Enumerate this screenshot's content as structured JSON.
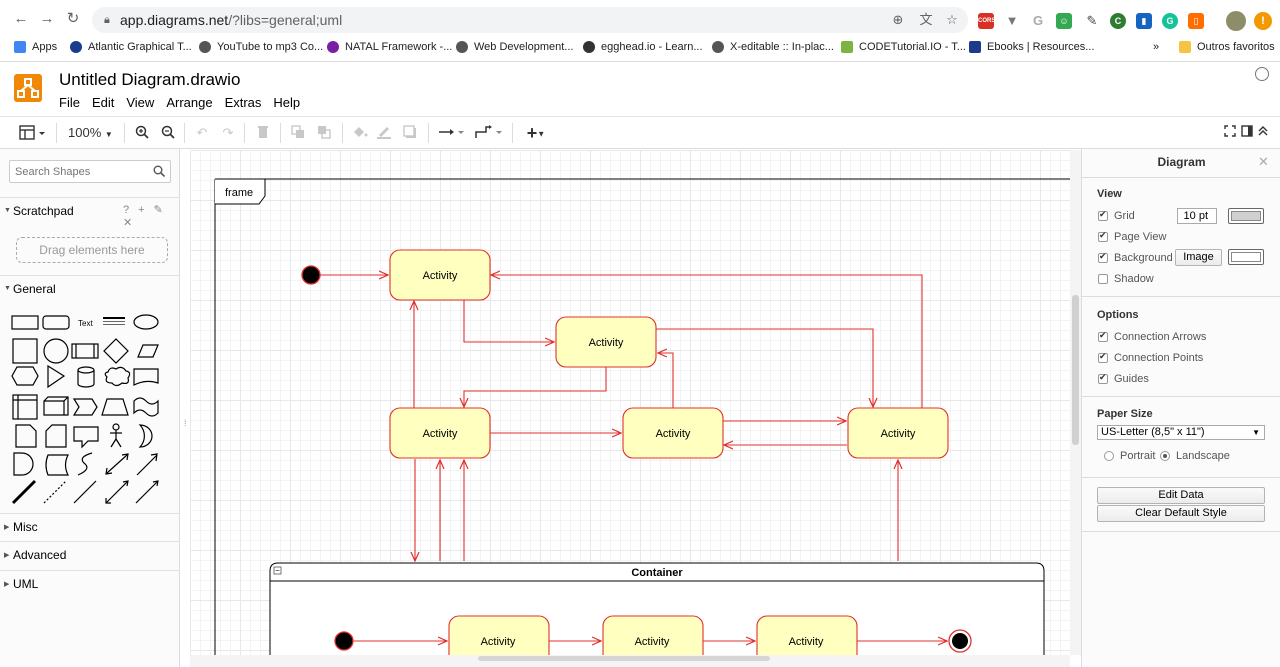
{
  "browser": {
    "url_host": "app.diagrams.net",
    "url_path": "/?libs=general;uml",
    "bookmarks": [
      {
        "label": "Apps",
        "color": "#4285f4"
      },
      {
        "label": "Atlantic Graphical T...",
        "color": "#1a3c8c"
      },
      {
        "label": "YouTube to mp3 Co...",
        "color": "#555555"
      },
      {
        "label": "NATAL Framework -...",
        "color": "#7b1fa2"
      },
      {
        "label": "Web Development...",
        "color": "#555555"
      },
      {
        "label": "egghead.io - Learn...",
        "color": "#333333"
      },
      {
        "label": "X-editable :: In-plac...",
        "color": "#555555"
      },
      {
        "label": "CODETutorial.IO - T...",
        "color": "#7cb342"
      },
      {
        "label": "Ebooks | Resources...",
        "color": "#1e3a8a"
      },
      {
        "label": "Outros favoritos",
        "color": "#f5c542"
      }
    ],
    "more_bookmarks": "»",
    "ext_cors": "CORS"
  },
  "app": {
    "title": "Untitled Diagram.drawio",
    "menu": [
      "File",
      "Edit",
      "View",
      "Arrange",
      "Extras",
      "Help"
    ],
    "zoom": "100%"
  },
  "sidebar": {
    "search_placeholder": "Search Shapes",
    "scratchpad": "Scratchpad",
    "scratch_tools": "? + ✎ ✕",
    "drag_here": "Drag elements here",
    "general": "General",
    "text_shape": "Text",
    "misc": "Misc",
    "advanced": "Advanced",
    "uml": "UML"
  },
  "diagram": {
    "frame_label": "frame",
    "container_label": "Container",
    "activity_label": "Activity",
    "line_color": "#e0302e",
    "fill_color": "#ffffc0"
  },
  "panel": {
    "title": "Diagram",
    "view": "View",
    "grid": "Grid",
    "grid_size": "10 pt",
    "page_view": "Page View",
    "background": "Background",
    "image_btn": "Image",
    "shadow": "Shadow",
    "options": "Options",
    "connection_arrows": "Connection Arrows",
    "connection_points": "Connection Points",
    "guides": "Guides",
    "paper_size": "Paper Size",
    "paper_value": "US-Letter (8,5\" x 11\")",
    "portrait": "Portrait",
    "landscape": "Landscape",
    "edit_data": "Edit Data",
    "clear_style": "Clear Default Style"
  }
}
